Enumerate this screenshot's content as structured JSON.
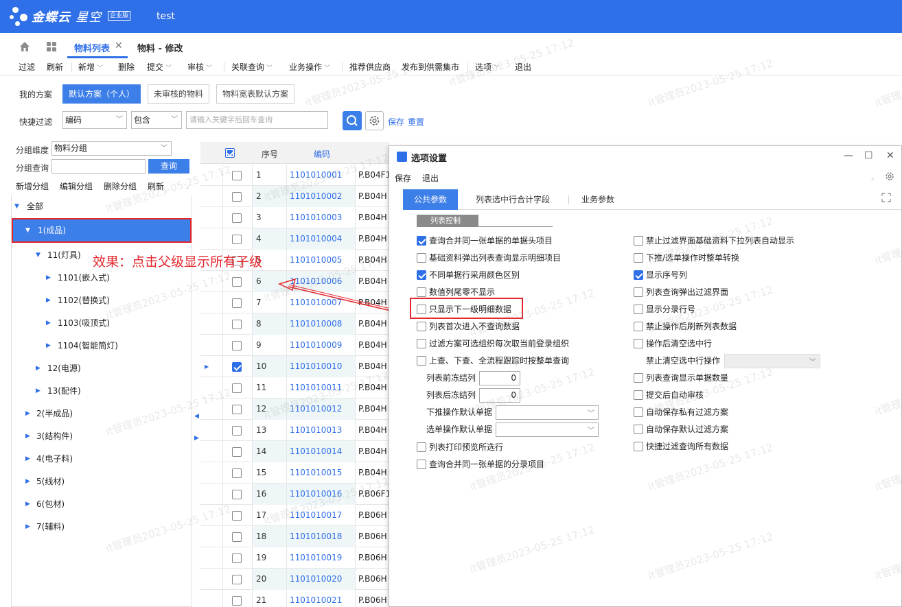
{
  "app": {
    "brand": "金蝶云",
    "brand_sub": "星空",
    "edition": "企业版",
    "title": "test"
  },
  "tabs": [
    {
      "label": "物料列表"
    },
    {
      "label": "物料 - 修改"
    }
  ],
  "toolbar": [
    "过滤",
    "刷新",
    "新增",
    "删除",
    "提交",
    "审核",
    "关联查询",
    "业务操作",
    "推荐供应商",
    "发布到供需集市",
    "选项",
    "退出"
  ],
  "scheme": {
    "label": "我的方案",
    "items": [
      "默认方案（个人）",
      "未审核的物料",
      "物料宽表默认方案"
    ]
  },
  "quick_filter": {
    "label": "快捷过滤",
    "field": "编码",
    "op": "包含",
    "placeholder": "请输入关键字后回车查询",
    "save": "保存",
    "reset": "重置"
  },
  "group": {
    "dim_label": "分组维度",
    "dim_value": "物料分组",
    "query_label": "分组查询",
    "query_btn": "查询",
    "actions": [
      "新增分组",
      "编辑分组",
      "删除分组",
      "刷新"
    ]
  },
  "tree": [
    "全部",
    "1(成品)",
    "11(灯具)",
    "1101(嵌入式)",
    "1102(替换式)",
    "1103(吸顶式)",
    "1104(智能筒灯)",
    "12(电源)",
    "13(配件)",
    "2(半成品)",
    "3(结构件)",
    "4(电子料)",
    "5(线材)",
    "6(包材)",
    "7(辅料)"
  ],
  "annotation": "效果：点击父级显示所有子级",
  "grid": {
    "headers": {
      "seq": "序号",
      "code": "编码"
    },
    "rows": [
      {
        "seq": "1",
        "code": "1101010001",
        "name": "P.B04F1",
        "checked": false
      },
      {
        "seq": "2",
        "code": "1101010002",
        "name": "P.B04H",
        "checked": false
      },
      {
        "seq": "3",
        "code": "1101010003",
        "name": "P.B04H",
        "checked": false
      },
      {
        "seq": "4",
        "code": "1101010004",
        "name": "P.B04H",
        "checked": false
      },
      {
        "seq": "5",
        "code": "1101010005",
        "name": "P.B04H",
        "checked": false
      },
      {
        "seq": "6",
        "code": "1101010006",
        "name": "P.B04H",
        "checked": false
      },
      {
        "seq": "7",
        "code": "1101010007",
        "name": "P.B04H",
        "checked": false
      },
      {
        "seq": "8",
        "code": "1101010008",
        "name": "P.B04H",
        "checked": false
      },
      {
        "seq": "9",
        "code": "1101010009",
        "name": "P.B04H",
        "checked": false
      },
      {
        "seq": "10",
        "code": "1101010010",
        "name": "P.B04H",
        "checked": true
      },
      {
        "seq": "11",
        "code": "1101010011",
        "name": "P.B04H",
        "checked": false
      },
      {
        "seq": "12",
        "code": "1101010012",
        "name": "P.B04H",
        "checked": false
      },
      {
        "seq": "13",
        "code": "1101010013",
        "name": "P.B04H",
        "checked": false
      },
      {
        "seq": "14",
        "code": "1101010014",
        "name": "P.B04H",
        "checked": false
      },
      {
        "seq": "15",
        "code": "1101010015",
        "name": "P.B04H",
        "checked": false
      },
      {
        "seq": "16",
        "code": "1101010016",
        "name": "P.B06F1",
        "checked": false
      },
      {
        "seq": "17",
        "code": "1101010017",
        "name": "P.B06H",
        "checked": false
      },
      {
        "seq": "18",
        "code": "1101010018",
        "name": "P.B06H",
        "checked": false
      },
      {
        "seq": "19",
        "code": "1101010019",
        "name": "P.B06H",
        "checked": false
      },
      {
        "seq": "20",
        "code": "1101010020",
        "name": "P.B06H",
        "checked": false
      },
      {
        "seq": "21",
        "code": "1101010021",
        "name": "P.B06H",
        "checked": false
      }
    ]
  },
  "dialog": {
    "title": "选项设置",
    "menu": [
      "保存",
      "退出"
    ],
    "tabs": [
      "公共参数",
      "列表选中行合计字段",
      "业务参数"
    ],
    "section": "列表控制",
    "left_options": [
      {
        "label": "查询合并同一张单据的单据头项目",
        "checked": true
      },
      {
        "label": "基础资料弹出列表查询显示明细项目",
        "checked": false
      },
      {
        "label": "不同单据行采用颜色区别",
        "checked": true
      },
      {
        "label": "数值列尾零不显示",
        "checked": false
      },
      {
        "label": "只显示下一级明细数据",
        "checked": false
      },
      {
        "label": "列表首次进入不查询数据",
        "checked": false
      },
      {
        "label": "过滤方案可选组织每次取当前登录组织",
        "checked": false
      },
      {
        "label": "上查、下查、全流程跟踪时按整单查询",
        "checked": false
      }
    ],
    "freeze_front": {
      "label": "列表前冻结列",
      "value": "0"
    },
    "freeze_back": {
      "label": "列表后冻结列",
      "value": "0"
    },
    "push_default": {
      "label": "下推操作默认单据"
    },
    "select_default": {
      "label": "选单操作默认单据"
    },
    "left_options2": [
      {
        "label": "列表打印预览所选行",
        "checked": false
      },
      {
        "label": "查询合并同一张单据的分录项目",
        "checked": false
      }
    ],
    "right_options": [
      {
        "label": "禁止过滤界面基础资料下拉列表自动显示",
        "checked": false
      },
      {
        "label": "下推/选单操作时整单转换",
        "checked": false
      },
      {
        "label": "显示序号列",
        "checked": true
      },
      {
        "label": "列表查询弹出过滤界面",
        "checked": false
      },
      {
        "label": "显示分录行号",
        "checked": false
      },
      {
        "label": "禁止操作后刷新列表数据",
        "checked": false
      },
      {
        "label": "操作后清空选中行",
        "checked": false
      }
    ],
    "forbid_clear": {
      "label": "禁止清空选中行操作"
    },
    "right_options2": [
      {
        "label": "列表查询显示单据数量",
        "checked": false
      },
      {
        "label": "提交后自动审核",
        "checked": false
      },
      {
        "label": "自动保存私有过滤方案",
        "checked": false
      },
      {
        "label": "自动保存默认过滤方案",
        "checked": false
      },
      {
        "label": "快捷过滤查询所有数据",
        "checked": false
      }
    ]
  },
  "watermark": "it管理员2023-05-25 17:12"
}
